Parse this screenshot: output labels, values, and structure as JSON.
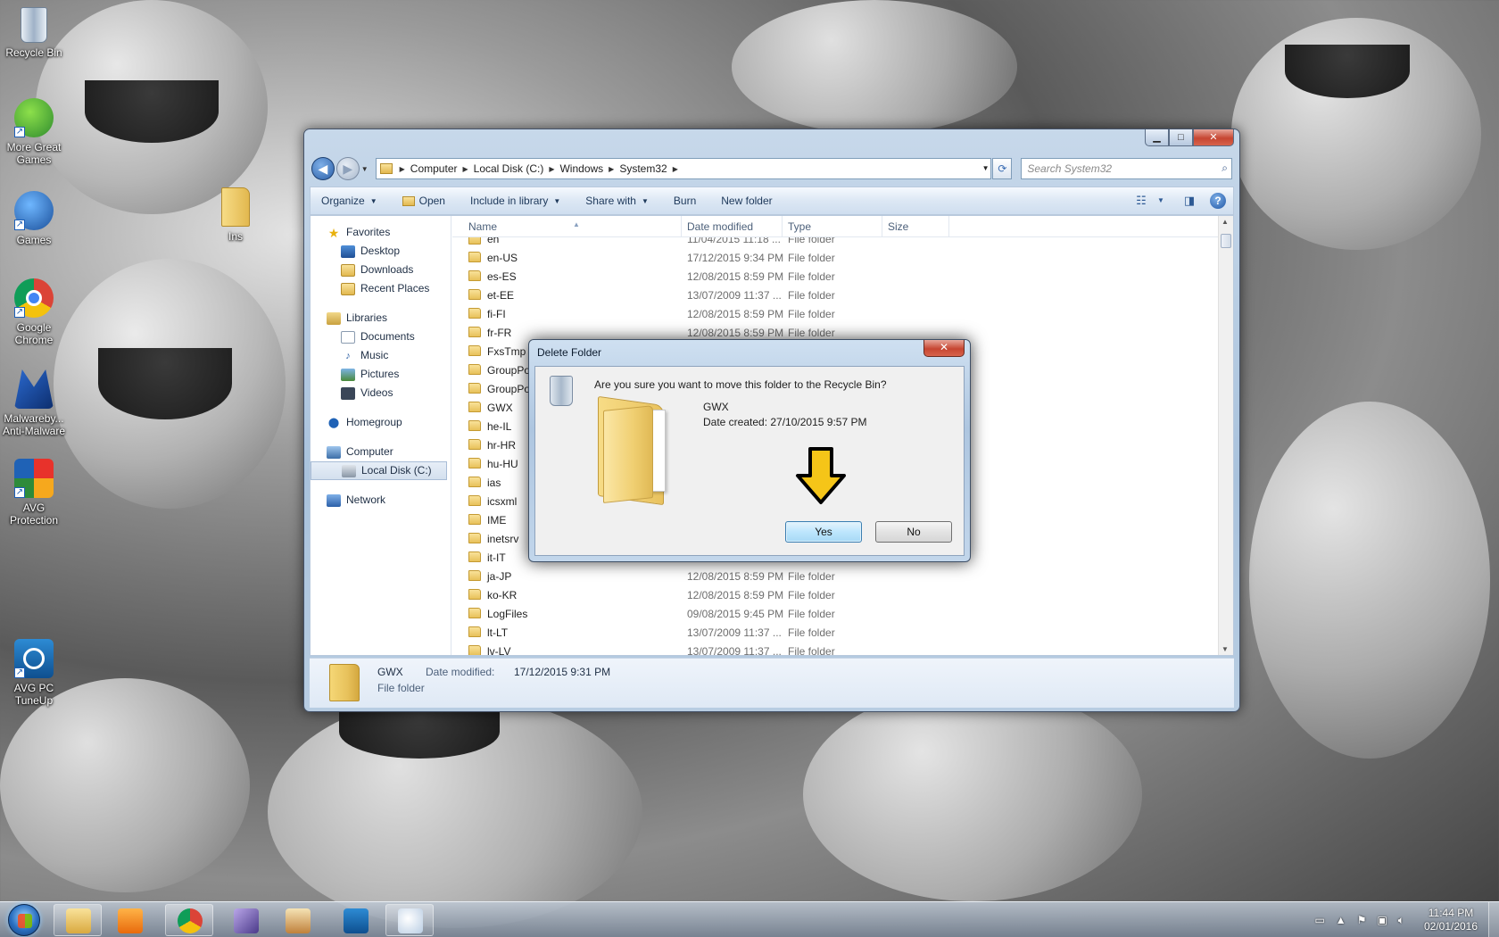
{
  "desktop": {
    "icons": [
      {
        "label": "Recycle Bin",
        "icon": "recycle-bin-icon"
      },
      {
        "label": "More Great Games",
        "icon": "games-icon"
      },
      {
        "label": "Games",
        "icon": "big-fish-games-icon"
      },
      {
        "label": "Google Chrome",
        "icon": "chrome-icon"
      },
      {
        "label": "Malwareby... Anti-Malware",
        "icon": "malwarebytes-icon"
      },
      {
        "label": "AVG Protection",
        "icon": "avg-icon"
      },
      {
        "label": "AVG PC TuneUp",
        "icon": "tuneup-icon"
      },
      {
        "label": "Ins",
        "icon": "folder-icon"
      }
    ]
  },
  "explorer": {
    "address": [
      "Computer",
      "Local Disk (C:)",
      "Windows",
      "System32"
    ],
    "search_placeholder": "Search System32",
    "toolbar": {
      "organize": "Organize",
      "open": "Open",
      "include_in_library": "Include in library",
      "share_with": "Share with",
      "burn": "Burn",
      "new_folder": "New folder"
    },
    "nav": {
      "favorites": "Favorites",
      "desktop": "Desktop",
      "downloads": "Downloads",
      "recent_places": "Recent Places",
      "libraries": "Libraries",
      "documents": "Documents",
      "music": "Music",
      "pictures": "Pictures",
      "videos": "Videos",
      "homegroup": "Homegroup",
      "computer": "Computer",
      "local_disk": "Local Disk (C:)",
      "network": "Network"
    },
    "columns": {
      "name": "Name",
      "date_modified": "Date modified",
      "type": "Type",
      "size": "Size"
    },
    "rows": [
      {
        "name": "en",
        "date": "11/04/2015 11:18 ...",
        "type": "File folder"
      },
      {
        "name": "en-US",
        "date": "17/12/2015 9:34 PM",
        "type": "File folder"
      },
      {
        "name": "es-ES",
        "date": "12/08/2015 8:59 PM",
        "type": "File folder"
      },
      {
        "name": "et-EE",
        "date": "13/07/2009 11:37 ...",
        "type": "File folder"
      },
      {
        "name": "fi-FI",
        "date": "12/08/2015 8:59 PM",
        "type": "File folder"
      },
      {
        "name": "fr-FR",
        "date": "12/08/2015 8:59 PM",
        "type": "File folder"
      },
      {
        "name": "FxsTmp",
        "date": "",
        "type": ""
      },
      {
        "name": "GroupPo",
        "date": "",
        "type": ""
      },
      {
        "name": "GroupPo",
        "date": "",
        "type": ""
      },
      {
        "name": "GWX",
        "date": "",
        "type": ""
      },
      {
        "name": "he-IL",
        "date": "",
        "type": ""
      },
      {
        "name": "hr-HR",
        "date": "",
        "type": ""
      },
      {
        "name": "hu-HU",
        "date": "",
        "type": ""
      },
      {
        "name": "ias",
        "date": "",
        "type": ""
      },
      {
        "name": "icsxml",
        "date": "",
        "type": ""
      },
      {
        "name": "IME",
        "date": "",
        "type": ""
      },
      {
        "name": "inetsrv",
        "date": "",
        "type": ""
      },
      {
        "name": "it-IT",
        "date": "",
        "type": ""
      },
      {
        "name": "ja-JP",
        "date": "12/08/2015 8:59 PM",
        "type": "File folder"
      },
      {
        "name": "ko-KR",
        "date": "12/08/2015 8:59 PM",
        "type": "File folder"
      },
      {
        "name": "LogFiles",
        "date": "09/08/2015 9:45 PM",
        "type": "File folder"
      },
      {
        "name": "lt-LT",
        "date": "13/07/2009 11:37 ...",
        "type": "File folder"
      },
      {
        "name": "lv-LV",
        "date": "13/07/2009 11:37 ...",
        "type": "File folder"
      }
    ],
    "details": {
      "name": "GWX",
      "date_key": "Date modified:",
      "date_value": "17/12/2015 9:31 PM",
      "type": "File folder"
    }
  },
  "dialog": {
    "title": "Delete Folder",
    "question": "Are you sure you want to move this folder to the Recycle Bin?",
    "item_name": "GWX",
    "item_date": "Date created: 27/10/2015 9:57 PM",
    "yes": "Yes",
    "no": "No",
    "arrow_color": "#f5c518"
  },
  "taskbar": {
    "apps": [
      "explorer-icon",
      "media-player-icon",
      "chrome-icon",
      "app-icon",
      "app-icon",
      "tuneup-icon",
      "paint-icon"
    ],
    "time": "11:44 PM",
    "date": "02/01/2016"
  }
}
